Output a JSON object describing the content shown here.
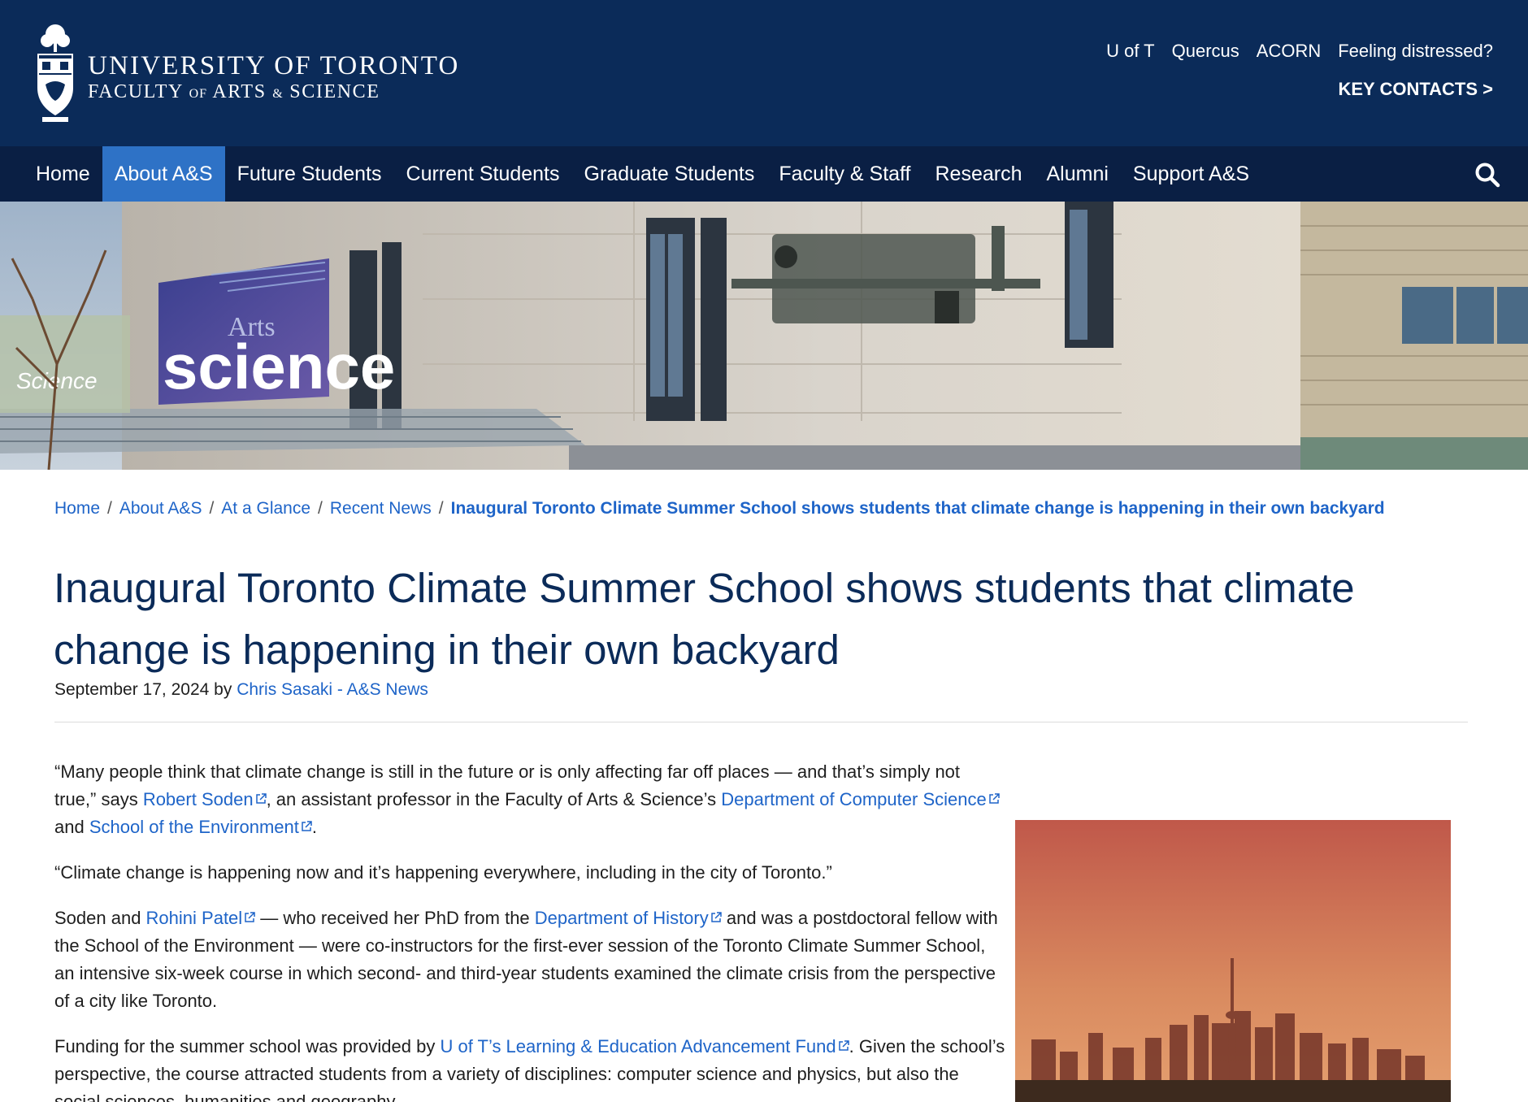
{
  "brand": {
    "line1": "UNIVERSITY OF TORONTO",
    "line2_a": "FACULTY ",
    "line2_of": "OF",
    "line2_b": " ARTS ",
    "line2_amp": "&",
    "line2_c": " SCIENCE"
  },
  "utility_links": [
    "U of T",
    "Quercus",
    "ACORN",
    "Feeling distressed?"
  ],
  "key_contacts": "KEY CONTACTS >",
  "nav": {
    "items": [
      "Home",
      "About A&S",
      "Future Students",
      "Current Students",
      "Graduate Students",
      "Faculty & Staff",
      "Research",
      "Alumni",
      "Support A&S"
    ],
    "active": "About A&S"
  },
  "hero": {
    "banner_small": "Arts",
    "banner_big": "science",
    "banner_left": "Science"
  },
  "breadcrumb": {
    "items": [
      "Home",
      "About A&S",
      "At a Glance",
      "Recent News"
    ],
    "separator": "/",
    "current": "Inaugural Toronto Climate Summer School shows students that climate change is happening in their own backyard"
  },
  "article": {
    "title": "Inaugural Toronto Climate Summer School shows students that climate change is happening in their own backyard",
    "date": "September 17, 2024",
    "by": "by",
    "author": "Chris Sasaki - A&S News",
    "p1": {
      "t1": "“Many people think that climate change is still in the future or is only affecting far off places — and that’s simply not true,” says ",
      "link1": "Robert Soden",
      "t2": ", an assistant professor in the Faculty of Arts & Science’s ",
      "link2": "Department of Computer Science",
      "t3": " and ",
      "link3": "School of the Environment",
      "t4": "."
    },
    "p2": "“Climate change is happening now and it’s happening everywhere, including in the city of Toronto.”",
    "p3": {
      "t1": "Soden and ",
      "link1": "Rohini Patel",
      "t2": " — who received her PhD from the ",
      "link2": "Department of History",
      "t3": " and was a postdoctoral fellow with the School of the Environment — were co-instructors for the first-ever session of the Toronto Climate Summer School, an intensive six-week course in which second- and third-year students examined the climate crisis from the perspective of a city like Toronto."
    },
    "p4": {
      "t1": "Funding for the summer school was provided by ",
      "link1": "U of T’s Learning & Education Advancement Fund",
      "t2": ". Given the school’s perspective, the course attracted students from a variety of disciplines: computer science and physics, but also the social sciences, humanities and geography."
    }
  },
  "colors": {
    "header_bg": "#0b2b59",
    "nav_bg": "#0a1f44",
    "nav_active": "#2e72c6",
    "link": "#1e64c8",
    "title": "#0b2b59"
  }
}
